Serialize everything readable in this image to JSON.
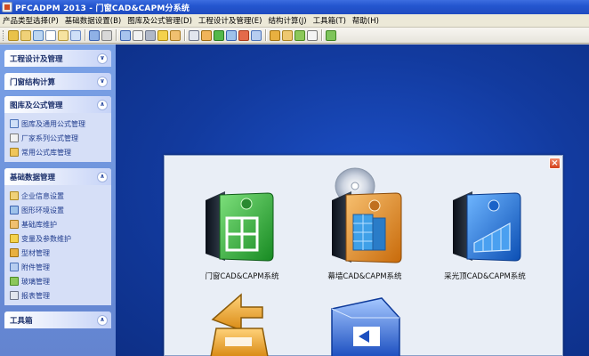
{
  "window": {
    "title": "PFCADPM 2013 - 门窗CAD&CAPM分系统"
  },
  "menu": [
    "产品类型选择(P)",
    "基础数据设置(B)",
    "图库及公式管理(D)",
    "工程设计及管理(E)",
    "结构计算(J)",
    "工具箱(T)",
    "帮助(H)"
  ],
  "sidebar": {
    "panels": [
      {
        "title": "工程设计及管理",
        "chevron": "¥",
        "items": []
      },
      {
        "title": "门窗结构计算",
        "chevron": "¥",
        "items": []
      },
      {
        "title": "图库及公式管理",
        "chevron": "︽",
        "items": [
          "图库及通用公式管理",
          "厂家系列公式管理",
          "常用公式库管理"
        ]
      },
      {
        "title": "基础数据管理",
        "chevron": "︽",
        "items": [
          "企业信息设置",
          "图形环境设置",
          "基础库维护",
          "变量及参数维护",
          "型材管理",
          "附件管理",
          "玻璃管理",
          "报表管理"
        ]
      },
      {
        "title": "工具箱",
        "chevron": "︽",
        "items": []
      }
    ]
  },
  "dialog": {
    "modules": [
      {
        "label": "门窗CAD&CAPM系统",
        "accent": "#2fa83a"
      },
      {
        "label": "幕墙CAD&CAPM系统",
        "accent": "#e08a1e"
      },
      {
        "label": "采光顶CAD&CAPM系统",
        "accent": "#1b74d8"
      }
    ],
    "close_icon": "close-icon"
  }
}
